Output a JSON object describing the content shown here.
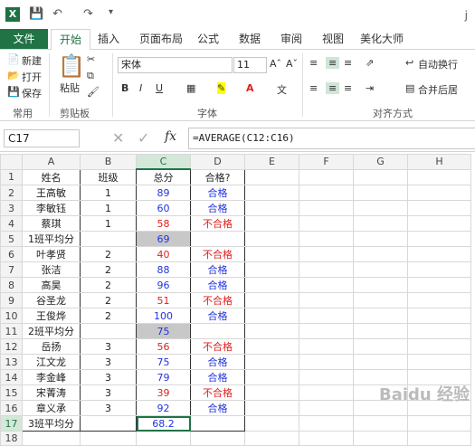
{
  "titlebar": {
    "right_char": "j"
  },
  "tabs": [
    "文件",
    "开始",
    "插入",
    "页面布局",
    "公式",
    "数据",
    "审阅",
    "视图",
    "美化大师"
  ],
  "ribbon": {
    "new": "新建",
    "open": "打开",
    "save": "保存",
    "group_common": "常用",
    "paste": "粘贴",
    "group_clipboard": "剪贴板",
    "font_name": "宋体",
    "font_size": "11",
    "group_font": "字体",
    "wrap": "自动换行",
    "merge": "合并后居",
    "group_align": "对齐方式"
  },
  "formula_bar": {
    "name_box": "C17",
    "fx": "fx",
    "formula": "=AVERAGE(C12:C16)"
  },
  "columns": [
    "A",
    "B",
    "C",
    "D",
    "E",
    "F",
    "G",
    "H"
  ],
  "rows": [
    {
      "n": "1",
      "a": "姓名",
      "b": "班级",
      "c": "总分",
      "d": "合格?",
      "cc": "",
      "dc": ""
    },
    {
      "n": "2",
      "a": "王高敏",
      "b": "1",
      "c": "89",
      "d": "合格",
      "cc": "blue",
      "dc": "blue"
    },
    {
      "n": "3",
      "a": "李敏钰",
      "b": "1",
      "c": "60",
      "d": "合格",
      "cc": "blue",
      "dc": "blue"
    },
    {
      "n": "4",
      "a": "蔡琪",
      "b": "1",
      "c": "58",
      "d": "不合格",
      "cc": "red",
      "dc": "red"
    },
    {
      "n": "5",
      "a": "1班平均分",
      "b": "",
      "c": "69",
      "d": "",
      "cc": "blue gray",
      "dc": ""
    },
    {
      "n": "6",
      "a": "叶孝贤",
      "b": "2",
      "c": "40",
      "d": "不合格",
      "cc": "red",
      "dc": "red"
    },
    {
      "n": "7",
      "a": "张洁",
      "b": "2",
      "c": "88",
      "d": "合格",
      "cc": "blue",
      "dc": "blue"
    },
    {
      "n": "8",
      "a": "高昊",
      "b": "2",
      "c": "96",
      "d": "合格",
      "cc": "blue",
      "dc": "blue"
    },
    {
      "n": "9",
      "a": "谷圣龙",
      "b": "2",
      "c": "51",
      "d": "不合格",
      "cc": "red",
      "dc": "red"
    },
    {
      "n": "10",
      "a": "王俊烨",
      "b": "2",
      "c": "100",
      "d": "合格",
      "cc": "blue",
      "dc": "blue"
    },
    {
      "n": "11",
      "a": "2班平均分",
      "b": "",
      "c": "75",
      "d": "",
      "cc": "blue gray",
      "dc": ""
    },
    {
      "n": "12",
      "a": "岳扬",
      "b": "3",
      "c": "56",
      "d": "不合格",
      "cc": "red",
      "dc": "red"
    },
    {
      "n": "13",
      "a": "江文龙",
      "b": "3",
      "c": "75",
      "d": "合格",
      "cc": "blue",
      "dc": "blue"
    },
    {
      "n": "14",
      "a": "李金峰",
      "b": "3",
      "c": "79",
      "d": "合格",
      "cc": "blue",
      "dc": "blue"
    },
    {
      "n": "15",
      "a": "宋菁涛",
      "b": "3",
      "c": "39",
      "d": "不合格",
      "cc": "red",
      "dc": "red"
    },
    {
      "n": "16",
      "a": "章义承",
      "b": "3",
      "c": "92",
      "d": "合格",
      "cc": "blue",
      "dc": "blue"
    },
    {
      "n": "17",
      "a": "3班平均分",
      "b": "",
      "c": "68.2",
      "d": "",
      "cc": "blue",
      "dc": ""
    },
    {
      "n": "18",
      "a": "",
      "b": "",
      "c": "",
      "d": "",
      "cc": "",
      "dc": ""
    }
  ],
  "watermark": "Baidu 经验"
}
